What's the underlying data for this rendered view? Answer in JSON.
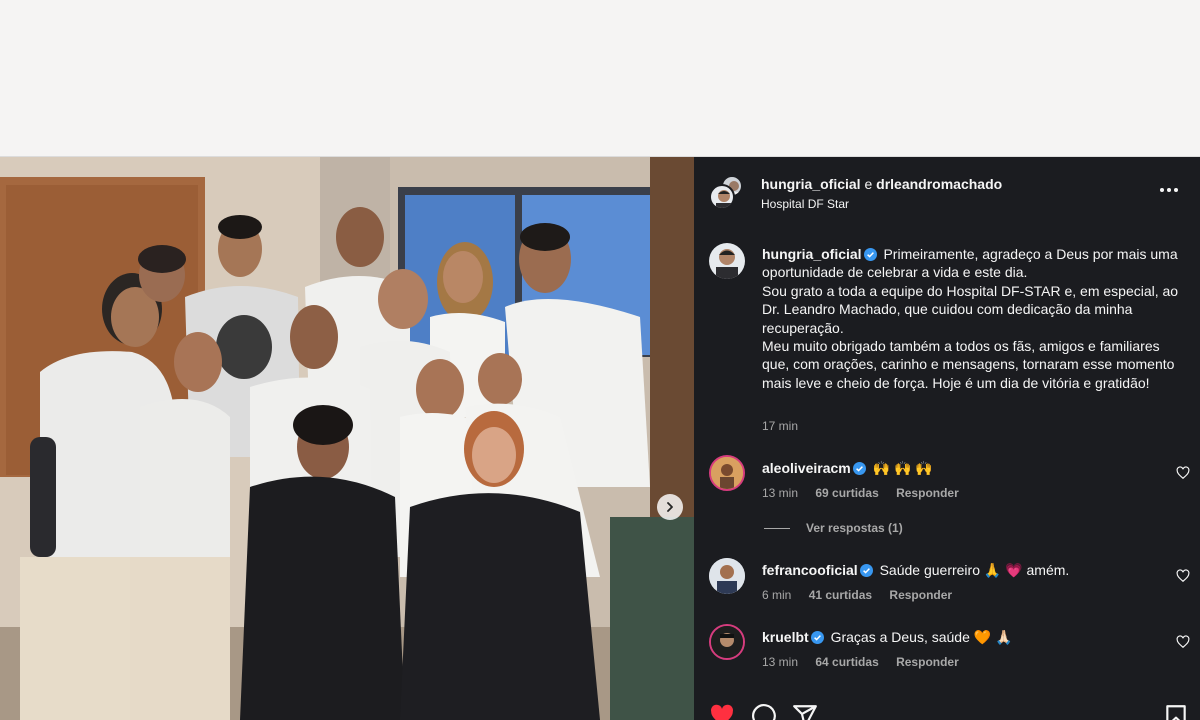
{
  "post": {
    "header": {
      "username": "hungria_oficial",
      "connector": "e",
      "collaborator": "drleandromachado",
      "location": "Hospital DF Star"
    },
    "caption": {
      "username": "hungria_oficial",
      "lines": [
        "Primeiramente, agradeço a Deus por mais uma oportunidade de celebrar a vida e este dia.",
        "Sou grato a toda a equipe do Hospital DF-STAR e, em especial, ao Dr. Leandro Machado, que cuidou com dedicação da minha recuperação.",
        "Meu muito obrigado também a todos os fãs, amigos e familiares que, com orações, carinho e mensagens, tornaram esse momento mais leve e cheio de força. Hoje é um dia de vitória e gratidão!"
      ],
      "time": "17 min"
    },
    "comments": [
      {
        "username": "aleoliveiracm",
        "text": "🙌 🙌 🙌",
        "time": "13 min",
        "likes": "69 curtidas",
        "reply": "Responder",
        "view_replies": "Ver respostas (1)"
      },
      {
        "username": "fefrancooficial",
        "text": "Saúde guerreiro 🙏 💗 amém.",
        "time": "6 min",
        "likes": "41 curtidas",
        "reply": "Responder"
      },
      {
        "username": "kruelbt",
        "text": "Graças a Deus, saúde 🧡 🙏🏻",
        "time": "13 min",
        "likes": "64 curtidas",
        "reply": "Responder"
      }
    ],
    "icons": [
      "verified-icon",
      "more-icon",
      "heart-icon",
      "comment-icon",
      "share-icon",
      "bookmark-icon",
      "next-arrow-icon"
    ],
    "colors": {
      "panel_bg": "#1b1c20",
      "text": "#f5f5f5",
      "muted": "#a8a8a8",
      "verified": "#3897f0",
      "liked": "#ff3040"
    }
  }
}
